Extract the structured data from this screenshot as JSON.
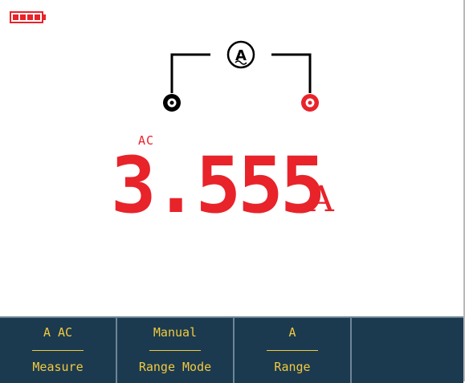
{
  "status": {
    "battery_icon": "battery-full-icon",
    "battery_color": "#e8232a"
  },
  "diagram": {
    "meter_icon": "ammeter-icon",
    "left_terminal_icon": "com-terminal-icon",
    "right_terminal_icon": "a-terminal-icon",
    "left_terminal_color": "#000000",
    "right_terminal_color": "#e8232a"
  },
  "measurement": {
    "mode": "AC",
    "value": "3.555",
    "unit": "A",
    "color": "#e8232a"
  },
  "softkeys": [
    {
      "value": "A AC",
      "label": "Measure"
    },
    {
      "value": "Manual",
      "label": "Range Mode"
    },
    {
      "value": "A",
      "label": "Range"
    }
  ],
  "theme": {
    "softkey_bg": "#1b3a4f",
    "softkey_text": "#f2c93f"
  }
}
